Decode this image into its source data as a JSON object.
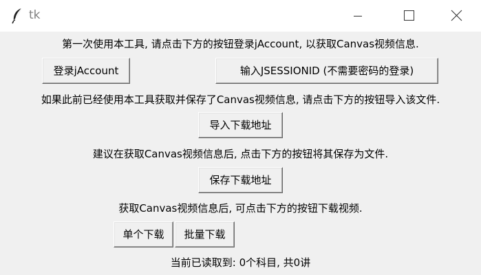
{
  "window": {
    "title": "tk",
    "icon": "feather-icon",
    "controls": [
      "minimize-icon",
      "maximize-icon",
      "close-icon"
    ]
  },
  "instructions": {
    "login_hint": "第一次使用本工具, 请点击下方的按钮登录jAccount, 以获取Canvas视频信息.",
    "import_hint": "如果此前已经使用本工具获取并保存了Canvas视频信息, 请点击下方的按钮导入该文件.",
    "save_hint": "建议在获取Canvas视频信息后, 点击下方的按钮将其保存为文件.",
    "download_hint": "获取Canvas视频信息后, 可点击下方的按钮下载视频."
  },
  "buttons": {
    "login_jaccount": "登录jAccount",
    "input_jsessionid": "输入JSESSIONID (不需要密码的登录)",
    "import_urls": "导入下载地址",
    "save_urls": "保存下载地址",
    "single_download": "单个下载",
    "batch_download": "批量下载"
  },
  "status": {
    "read_summary": "当前已读取到: 0个科目, 共0讲"
  }
}
